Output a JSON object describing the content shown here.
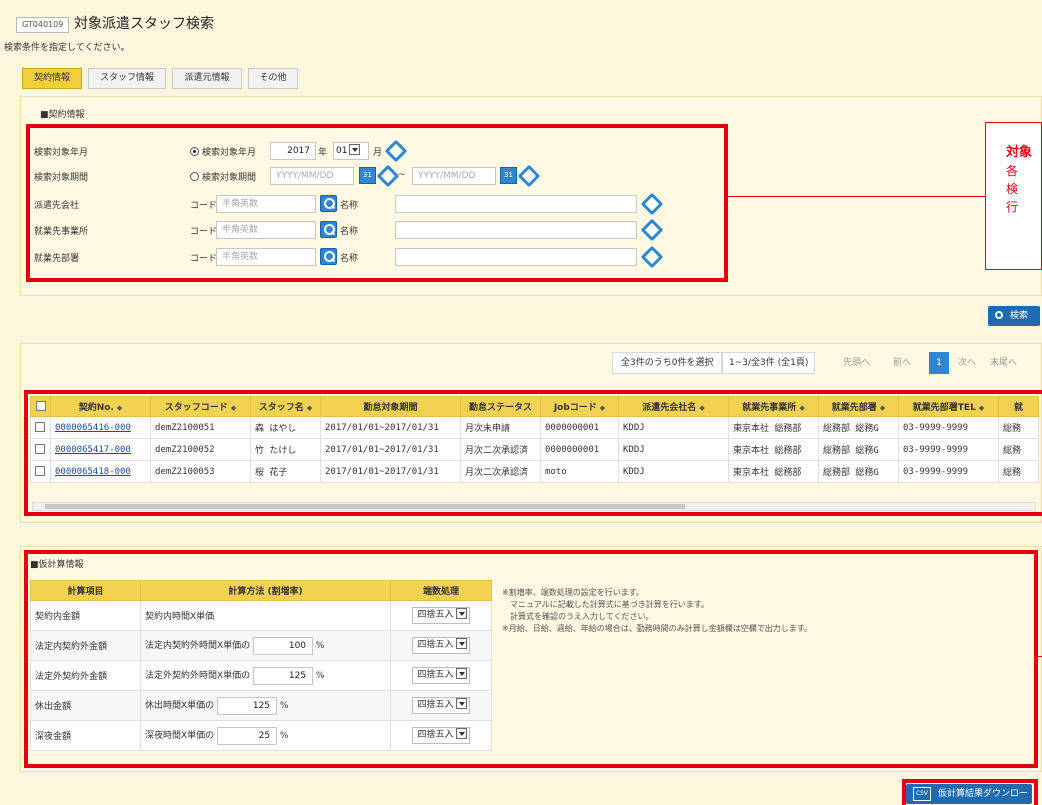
{
  "header": {
    "screen_id": "GT040109",
    "title": "対象派遣スタッフ検索",
    "subtitle": "検索条件を指定してください。"
  },
  "tabs": [
    {
      "label": "契約情報",
      "active": true
    },
    {
      "label": "スタッフ情報",
      "active": false
    },
    {
      "label": "派遣元情報",
      "active": false
    },
    {
      "label": "その他",
      "active": false
    }
  ],
  "contract": {
    "section_title": "■契約情報",
    "period_year_month": {
      "label": "検索対象年月",
      "radio_label": "検索対象年月",
      "year_value": "2017",
      "year_unit": "年",
      "month_value": "01",
      "month_unit": "月"
    },
    "period_range": {
      "label": "検索対象期間",
      "radio_label": "検索対象期間",
      "from_placeholder": "YYYY/MM/DD",
      "tilde": "~",
      "to_placeholder": "YYYY/MM/DD",
      "calendar_glyph": "31"
    },
    "rows": [
      {
        "label": "派遣先会社",
        "code_label": "コード",
        "code_placeholder": "半角英数",
        "name_label": "名称"
      },
      {
        "label": "就業先事業所",
        "code_label": "コード",
        "code_placeholder": "半角英数",
        "name_label": "名称"
      },
      {
        "label": "就業先部署",
        "code_label": "コード",
        "code_placeholder": "半角英数",
        "name_label": "名称"
      }
    ]
  },
  "callout": {
    "line1": "対象",
    "line2": "各",
    "line3": "検",
    "line4": "行"
  },
  "search_button": "検索",
  "pager": {
    "selection": "全3件のうち0件を選択",
    "range": "1~3/全3件 (全1頁)",
    "first": "先頭へ",
    "prev": "前へ",
    "current": "1",
    "next": "次へ",
    "last": "末尾へ"
  },
  "grid": {
    "columns": [
      "契約No.",
      "スタッフコード",
      "スタッフ名",
      "勤怠対象期間",
      "勤怠ステータス",
      "Jobコード",
      "派遣先会社名",
      "就業先事業所",
      "就業先部署",
      "就業先部署TEL",
      "就"
    ],
    "rows": [
      [
        "0000065416-000",
        "demZ2100051",
        "森 はやし",
        "2017/01/01~2017/01/31",
        "月次未申請",
        "0000000001",
        "KDDJ",
        "東京本社 総務部",
        "総務部 総務G",
        "03-9999-9999",
        "総務"
      ],
      [
        "0000065417-000",
        "demZ2100052",
        "竹 たけし",
        "2017/01/01~2017/01/31",
        "月次二次承認済",
        "0000000001",
        "KDDJ",
        "東京本社 総務部",
        "総務部 総務G",
        "03-9999-9999",
        "総務"
      ],
      [
        "0000065418-000",
        "demZ2100053",
        "桜 花子",
        "2017/01/01~2017/01/31",
        "月次二次承認済",
        "moto",
        "KDDJ",
        "東京本社 総務部",
        "総務部 総務G",
        "03-9999-9999",
        "総務"
      ]
    ]
  },
  "calc": {
    "section_title": "■仮計算情報",
    "headers": [
      "計算項目",
      "計算方法 (割増率)",
      "端数処理"
    ],
    "rows": [
      {
        "item": "契約内金額",
        "method": "契約内時間X単価",
        "pct": "",
        "unit": "",
        "rounding": "四捨五入"
      },
      {
        "item": "法定内契約外金額",
        "method": "法定内契約外時間X単価の",
        "pct": "100",
        "unit": "%",
        "rounding": "四捨五入"
      },
      {
        "item": "法定外契約外金額",
        "method": "法定外契約外時間X単価の",
        "pct": "125",
        "unit": "%",
        "rounding": "四捨五入"
      },
      {
        "item": "休出金額",
        "method": "休出時間X単価の",
        "pct": "125",
        "unit": "%",
        "rounding": "四捨五入"
      },
      {
        "item": "深夜金額",
        "method": "深夜時間X単価の",
        "pct": "25",
        "unit": "%",
        "rounding": "四捨五入"
      }
    ],
    "notes": [
      "※割増率、端数処理の設定を行います。",
      "マニュアルに記載した計算式に基づき計算を行います。",
      "計算式を確認のうえ入力してください。",
      "※月給、日給、週給、年給の場合は、勤務時間のみ計算し金額欄は空欄で出力します。"
    ]
  },
  "download_button": "仮計算結果ダウンロード",
  "download_icon_text": "CSV"
}
